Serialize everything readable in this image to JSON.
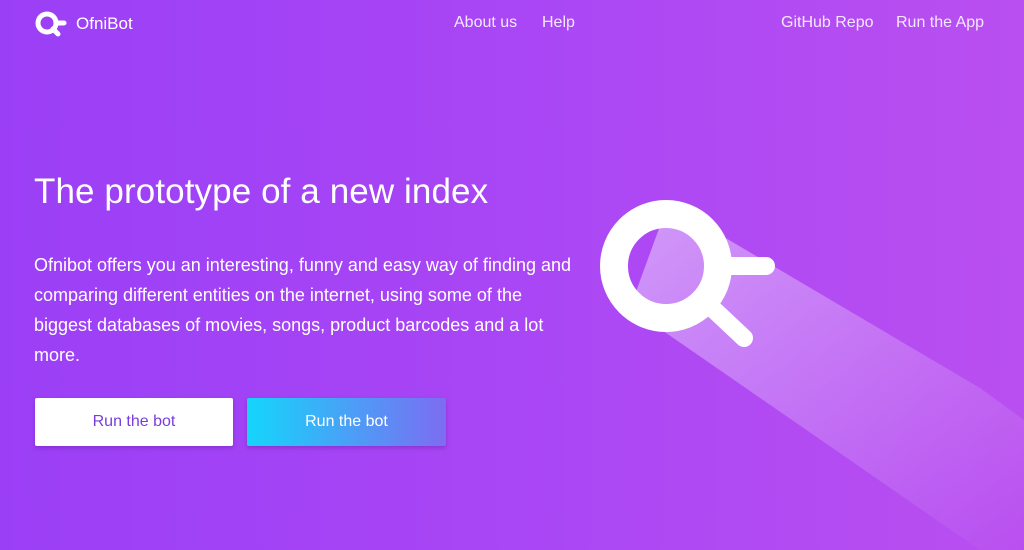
{
  "brand": {
    "name": "OfniBot",
    "logo_icon": "search-logo-icon"
  },
  "nav": {
    "about": "About us",
    "help": "Help",
    "github": "GitHub Repo",
    "run_app": "Run the App"
  },
  "hero": {
    "title": "The prototype of a new index",
    "description": "Ofnibot offers you an interesting, funny and easy way of finding and comparing different entities on the internet, using some of the biggest databases of movies, songs, product barcodes and a lot more.",
    "primary_button": "Run the bot",
    "secondary_button": "Run the bot",
    "illustration_icon": "magnifier-icon"
  },
  "colors": {
    "background_start": "#9b3ff6",
    "background_end": "#b94ff0",
    "primary_button_text": "#7a3ddb",
    "secondary_button_start": "#14d6fb",
    "secondary_button_end": "#7d6cf2"
  }
}
